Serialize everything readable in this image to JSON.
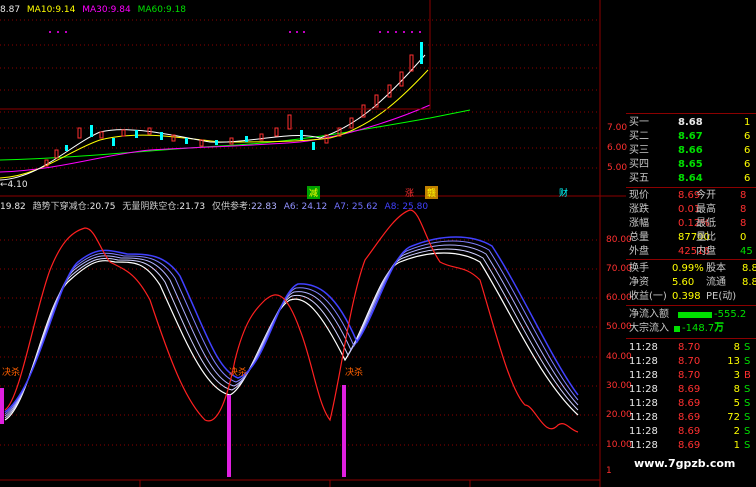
{
  "main_chart": {
    "legend": {
      "ma5": "8.87",
      "ma10_label": "MA10:",
      "ma10": "9.14",
      "ma30_label": "MA30:",
      "ma30": "9.84",
      "ma60_label": "MA60:",
      "ma60": "9.18"
    },
    "price_ticks": [
      "7.00",
      "6.00",
      "5.00"
    ],
    "low_label": "4.10",
    "event_markers": [
      "减",
      "涨",
      "赣",
      "财"
    ]
  },
  "indicator": {
    "header_value": "19.82",
    "name": "趋势下穿减仓:",
    "v1": "20.75",
    "name2": "无量阴跌空仓:",
    "v2": "21.73",
    "name3": "仅供参考:",
    "v3": "22.83",
    "a6": "A6: 24.12",
    "a7": "A7: 25.62",
    "a8": "A8: 25.80",
    "ticks": [
      "80.00",
      "70.00",
      "60.00",
      "50.00",
      "40.00",
      "30.00",
      "20.00",
      "10.00",
      "1"
    ],
    "signal_labels": [
      "决杀",
      "决杀",
      "决杀"
    ]
  },
  "quote_panel": {
    "bids": [
      {
        "label": "买一",
        "price": "8.68",
        "vol": "1"
      },
      {
        "label": "买二",
        "price": "8.67",
        "vol": "6"
      },
      {
        "label": "买三",
        "price": "8.66",
        "vol": "6"
      },
      {
        "label": "买四",
        "price": "8.65",
        "vol": "6"
      },
      {
        "label": "买五",
        "price": "8.64",
        "vol": "6"
      }
    ],
    "stats": [
      {
        "l1": "现价",
        "v1": "8.69",
        "l2": "今开",
        "v2": "8"
      },
      {
        "l1": "涨跌",
        "v1": "0.01",
        "l2": "最高",
        "v2": "8"
      },
      {
        "l1": "涨幅",
        "v1": "0.12%",
        "l2": "最低",
        "v2": "8"
      },
      {
        "l1": "总量",
        "v1": "87700",
        "l2": "量比",
        "v2": "0"
      },
      {
        "l1": "外盘",
        "v1": "42516",
        "l2": "内盘",
        "v2": "45"
      }
    ],
    "stats2": [
      {
        "l1": "换手",
        "v1": "0.99%",
        "l2": "股本",
        "v2": "8.8"
      },
      {
        "l1": "净资",
        "v1": "5.60",
        "l2": "流通",
        "v2": "8.8"
      },
      {
        "l1": "收益(一)",
        "v1": "0.398",
        "l2": "PE(动)",
        "v2": ""
      }
    ],
    "flows": [
      {
        "label": "净流入额",
        "value": "-555.2万"
      },
      {
        "label": "大宗流入",
        "value": "-148.7万"
      }
    ],
    "trades": [
      {
        "time": "11:28",
        "price": "8.70",
        "vol": "8",
        "side": "S"
      },
      {
        "time": "11:28",
        "price": "8.70",
        "vol": "13",
        "side": "S"
      },
      {
        "time": "11:28",
        "price": "8.70",
        "vol": "3",
        "side": "B"
      },
      {
        "time": "11:28",
        "price": "8.69",
        "vol": "8",
        "side": "S"
      },
      {
        "time": "11:28",
        "price": "8.69",
        "vol": "5",
        "side": "S"
      },
      {
        "time": "11:28",
        "price": "8.69",
        "vol": "72",
        "side": "S"
      },
      {
        "time": "11:28",
        "price": "8.69",
        "vol": "2",
        "side": "S"
      },
      {
        "time": "11:28",
        "price": "8.69",
        "vol": "1",
        "side": "S"
      }
    ]
  },
  "watermark": "www.7gpzb.com",
  "colors": {
    "up": "#ff3030",
    "down": "#00e000",
    "ma_white": "#ffffff",
    "ma_yellow": "#ffff00",
    "ma_purple": "#ff00ff",
    "ma_green": "#00ff00",
    "signal_bar": "#e020e0",
    "separator": "#8b0000"
  }
}
